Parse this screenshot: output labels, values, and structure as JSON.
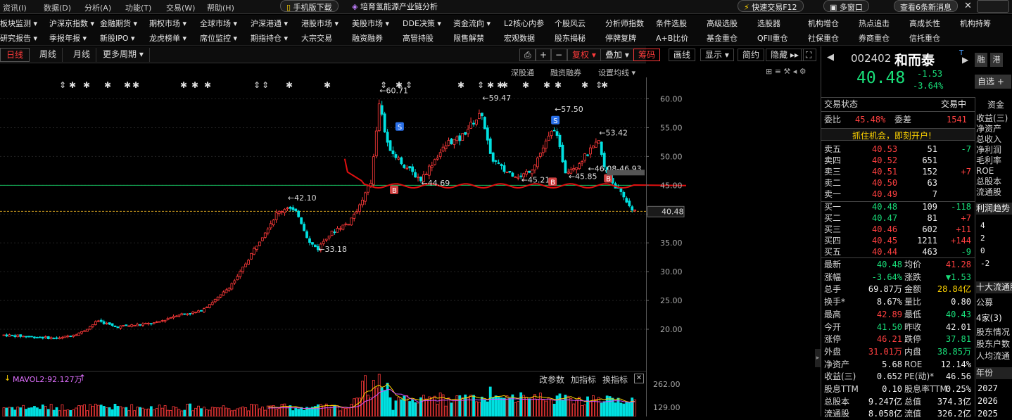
{
  "menubar": {
    "items": [
      "资讯(I)",
      "数据(D)",
      "分析(A)",
      "功能(T)",
      "交易(W)",
      "帮助(H)"
    ],
    "mobile_download": "手机版下载",
    "promo": "培育氢能源产业链分析",
    "quick_trade": "快速交易F12",
    "multi_window": "多窗口",
    "news_button": "查看6条新消息"
  },
  "nav_row1": [
    "板块监测",
    "沪深京指数",
    "金融期货",
    "期权市场",
    "全球市场",
    "沪深港通",
    "港股市场",
    "美股市场",
    "DDE决策",
    "资金流向",
    "L2核心内参",
    "个股风云",
    "分析师指数",
    "条件选股",
    "高级选股",
    "选股器",
    "机构增仓",
    "热点追击",
    "高成长性",
    "机构持筹"
  ],
  "nav_row2": [
    "研究报告",
    "季报年报",
    "新股IPO",
    "龙虎榜单",
    "席位监控",
    "期指持仓",
    "大宗交易",
    "融资融券",
    "高管持股",
    "限售解禁",
    "宏观数据",
    "股东揭秘",
    "停牌复牌",
    "A+B比价",
    "基金重仓",
    "QFII重仓",
    "社保重仓",
    "券商重仓",
    "信托重仓"
  ],
  "period_tabs": [
    "日线",
    "周线",
    "月线",
    "更多周期"
  ],
  "toolbar": {
    "fuquan": "复权",
    "overlay": "叠加",
    "chouma": "筹码",
    "draw": "画线",
    "display": "显示",
    "simple": "简约",
    "hide": "隐藏"
  },
  "chart_links": {
    "sgt": "深股通",
    "rzrq": "融资融券",
    "ma_settings": "设置均线"
  },
  "volume_header": {
    "label": "MAVOL2:92.127万",
    "params": "改参数",
    "add_indicator": "加指标",
    "switch_indicator": "换指标"
  },
  "chart_data": {
    "type": "candlestick",
    "price_axis_ticks": [
      "60.00",
      "55.00",
      "50.00",
      "45.00",
      "40.00",
      "35.00",
      "30.00",
      "25.00",
      "20.00"
    ],
    "price_range": [
      17.0,
      64.0
    ],
    "current_price_label": "40.48",
    "volume_axis_ticks": [
      "262.00",
      "129.00"
    ],
    "annotations": [
      {
        "text": "60.71",
        "x_index": 135,
        "price": 60.71
      },
      {
        "text": "59.47",
        "x_index": 172,
        "price": 59.47
      },
      {
        "text": "57.50",
        "x_index": 198,
        "price": 57.5
      },
      {
        "text": "53.42",
        "x_index": 214,
        "price": 53.42
      },
      {
        "text": "46.08-46.93",
        "x_index": 210,
        "price": 47.2
      },
      {
        "text": "45.85",
        "x_index": 203,
        "price": 45.85
      },
      {
        "text": "45.21",
        "x_index": 186,
        "price": 45.21
      },
      {
        "text": "44.69",
        "x_index": 150,
        "price": 44.69
      },
      {
        "text": "42.10",
        "x_index": 102,
        "price": 42.1
      },
      {
        "text": "33.18",
        "x_index": 113,
        "price": 33.18
      }
    ],
    "green_line_price": 45.0,
    "dashed_line_price": 40.48,
    "s_markers": [
      {
        "x_index": 142,
        "price": 55.2
      },
      {
        "x_index": 198,
        "price": 56.3
      }
    ],
    "b_markers": [
      {
        "x_index": 140,
        "price": 44.2
      },
      {
        "x_index": 197,
        "price": 45.6
      },
      {
        "x_index": 217,
        "price": 46.2
      }
    ],
    "candles_summary": "daily price series rising from about 19 to 60.71 then ranging 44-59 and falling to 40.48"
  },
  "quote": {
    "code": "002402",
    "name": "和而泰",
    "price": "40.48",
    "change": "-1.53",
    "change_pct": "-3.64%",
    "tags": [
      "融",
      "港"
    ],
    "add_watch": "自选",
    "trade_status_label": "交易状态",
    "trade_status": "交易中",
    "weibi_label": "委比",
    "weibi": "45.48%",
    "weicha_label": "委差",
    "weicha": "1541",
    "promo": "抓住机会，即刻开户!",
    "asks": [
      {
        "label": "卖五",
        "price": "40.53",
        "vol": "51",
        "chg": "-7"
      },
      {
        "label": "卖四",
        "price": "40.52",
        "vol": "651",
        "chg": ""
      },
      {
        "label": "卖三",
        "price": "40.51",
        "vol": "152",
        "chg": "+7"
      },
      {
        "label": "卖二",
        "price": "40.50",
        "vol": "63",
        "chg": ""
      },
      {
        "label": "卖一",
        "price": "40.49",
        "vol": "7",
        "chg": ""
      }
    ],
    "bids": [
      {
        "label": "买一",
        "price": "40.48",
        "vol": "109",
        "chg": "-118"
      },
      {
        "label": "买二",
        "price": "40.47",
        "vol": "81",
        "chg": "+7"
      },
      {
        "label": "买三",
        "price": "40.46",
        "vol": "602",
        "chg": "+11"
      },
      {
        "label": "买四",
        "price": "40.45",
        "vol": "1211",
        "chg": "+144"
      },
      {
        "label": "买五",
        "price": "40.44",
        "vol": "463",
        "chg": "-9"
      }
    ],
    "stats": [
      {
        "l1": "最新",
        "v1": "40.48",
        "c1": "dn",
        "l2": "均价",
        "v2": "41.28",
        "c2": "up"
      },
      {
        "l1": "涨幅",
        "v1": "-3.64%",
        "c1": "dn",
        "l2": "涨跌",
        "v2": "▼1.53",
        "c2": "dn"
      },
      {
        "l1": "总手",
        "v1": "69.87万",
        "c1": "wh",
        "l2": "金额",
        "v2": "28.84亿",
        "c2": "yl"
      },
      {
        "l1": "换手*",
        "v1": "8.67%",
        "c1": "wh",
        "l2": "量比",
        "v2": "0.80",
        "c2": "wh"
      },
      {
        "l1": "最高",
        "v1": "42.89",
        "c1": "up",
        "l2": "最低",
        "v2": "40.43",
        "c2": "dn"
      },
      {
        "l1": "今开",
        "v1": "41.50",
        "c1": "dn",
        "l2": "昨收",
        "v2": "42.01",
        "c2": "wh"
      },
      {
        "l1": "涨停",
        "v1": "46.21",
        "c1": "up",
        "l2": "跌停",
        "v2": "37.81",
        "c2": "dn"
      },
      {
        "l1": "外盘",
        "v1": "31.01万",
        "c1": "up",
        "l2": "内盘",
        "v2": "38.85万",
        "c2": "dn"
      },
      {
        "l1": "净资产",
        "v1": "5.68",
        "c1": "wh",
        "l2": "ROE",
        "v2": "12.14%",
        "c2": "wh"
      },
      {
        "l1": "收益(三)",
        "v1": "0.652",
        "c1": "wh",
        "l2": "PE(动)*",
        "v2": "46.56",
        "c2": "wh"
      },
      {
        "l1": "股息TTM",
        "v1": "0.10",
        "c1": "wh",
        "l2": "股息率TTM",
        "v2": "0.25%",
        "c2": "wh"
      },
      {
        "l1": "总股本",
        "v1": "9.247亿",
        "c1": "wh",
        "l2": "总值",
        "v2": "374.3亿",
        "c2": "wh"
      },
      {
        "l1": "流通股",
        "v1": "8.058亿",
        "c1": "wh",
        "l2": "流值",
        "v2": "326.2亿",
        "c2": "wh"
      }
    ]
  },
  "side_panel": {
    "tab": "资金",
    "items": [
      "收益(三)",
      "净资产",
      "总收入",
      "净利润",
      "毛利率",
      "ROE",
      "总股本",
      "流通股"
    ],
    "profit_trend": "利润趋势",
    "top_holders": "十大流通股",
    "company": "公募",
    "count": "4家(3)",
    "holder_items": [
      "股东情况",
      "股东户数",
      "人均流通"
    ],
    "year_label": "年份",
    "years": [
      "2027",
      "2026",
      "2025"
    ],
    "trend_ticks": [
      "4",
      "2",
      "0",
      "-2"
    ]
  }
}
